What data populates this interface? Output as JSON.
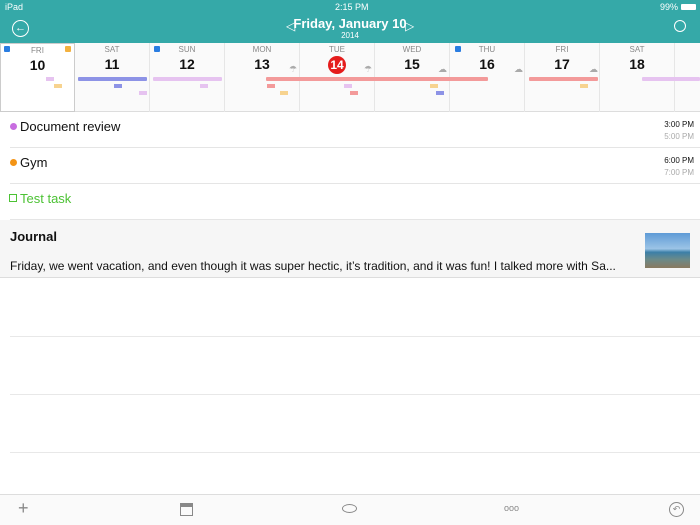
{
  "status": {
    "device": "iPad",
    "time": "2:15 PM",
    "battery": "99%"
  },
  "header": {
    "title": "Friday, January 10",
    "year": "2014",
    "back_icon": "back-arrow-circle-icon",
    "search_icon": "search-icon"
  },
  "days": [
    {
      "name": "FRI",
      "num": "10"
    },
    {
      "name": "SAT",
      "num": "11"
    },
    {
      "name": "SUN",
      "num": "12"
    },
    {
      "name": "MON",
      "num": "13"
    },
    {
      "name": "TUE",
      "num": "14"
    },
    {
      "name": "WED",
      "num": "15"
    },
    {
      "name": "THU",
      "num": "16"
    },
    {
      "name": "FRI",
      "num": "17"
    },
    {
      "name": "SAT",
      "num": "18"
    }
  ],
  "events": [
    {
      "title": "Document review",
      "color": "#c86de0",
      "start": "3:00 PM",
      "end": "5:00 PM"
    },
    {
      "title": "Gym",
      "color": "#f39416",
      "start": "6:00 PM",
      "end": "7:00 PM"
    }
  ],
  "task": {
    "title": "Test task",
    "color": "#4cc234"
  },
  "journal": {
    "title": "Journal",
    "text": "Friday, we went vacation, and even though it was super hectic, it’s tradition, and it was fun! I talked more with Sa..."
  },
  "toolbar": {
    "add": "+",
    "more": "ooo"
  },
  "colors": {
    "header": "#35a9a8",
    "today": "#e51c1c"
  }
}
